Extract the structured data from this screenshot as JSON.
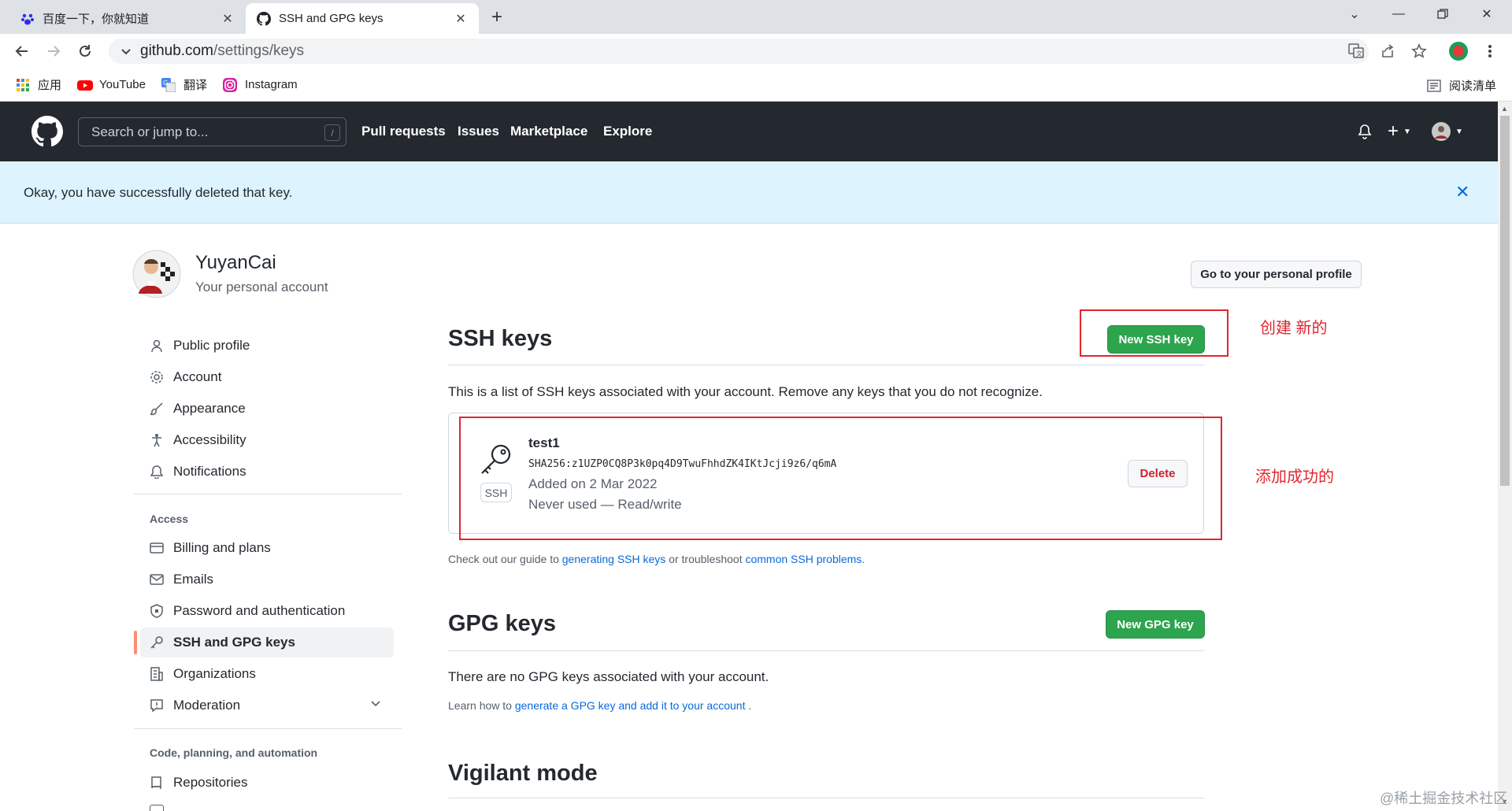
{
  "browser": {
    "tabs": [
      {
        "title": "百度一下，你就知道",
        "icon": "baidu-paw-icon",
        "active": false
      },
      {
        "title": "SSH and GPG keys",
        "icon": "github-icon",
        "active": true
      }
    ],
    "url_host": "github.com",
    "url_path": "/settings/keys",
    "bookmarks": [
      {
        "label": "应用",
        "icon": "apps-grid-icon"
      },
      {
        "label": "YouTube",
        "icon": "youtube-icon"
      },
      {
        "label": "翻译",
        "icon": "translate-icon"
      },
      {
        "label": "Instagram",
        "icon": "instagram-icon"
      }
    ],
    "reading_list": "阅读清单"
  },
  "github": {
    "search_placeholder": "Search or jump to...",
    "search_shortcut": "/",
    "nav": [
      "Pull requests",
      "Issues",
      "Marketplace",
      "Explore"
    ]
  },
  "flash": {
    "message": "Okay, you have successfully deleted that key.",
    "color": "#ddf4ff"
  },
  "account": {
    "name": "YuyanCai",
    "subtitle": "Your personal account",
    "profile_button": "Go to your personal profile"
  },
  "sidebar": {
    "items_top": [
      {
        "label": "Public profile",
        "icon": "person-icon"
      },
      {
        "label": "Account",
        "icon": "gear-icon"
      },
      {
        "label": "Appearance",
        "icon": "paintbrush-icon"
      },
      {
        "label": "Accessibility",
        "icon": "accessibility-icon"
      },
      {
        "label": "Notifications",
        "icon": "bell-icon"
      }
    ],
    "access_heading": "Access",
    "items_access": [
      {
        "label": "Billing and plans",
        "icon": "credit-card-icon"
      },
      {
        "label": "Emails",
        "icon": "mail-icon"
      },
      {
        "label": "Password and authentication",
        "icon": "shield-lock-icon"
      },
      {
        "label": "SSH and GPG keys",
        "icon": "key-icon",
        "selected": true
      },
      {
        "label": "Organizations",
        "icon": "organization-icon"
      },
      {
        "label": "Moderation",
        "icon": "report-icon"
      }
    ],
    "code_heading": "Code, planning, and automation",
    "items_code": [
      {
        "label": "Repositories",
        "icon": "repo-icon"
      }
    ]
  },
  "ssh": {
    "title": "SSH keys",
    "new_button": "New SSH key",
    "description": "This is a list of SSH keys associated with your account. Remove any keys that you do not recognize.",
    "key": {
      "name": "test1",
      "fingerprint": "SHA256:z1UZP0CQ8P3k0pq4D9TwuFhhdZK4IKtJcji9z6/q6mA",
      "added": "Added on 2 Mar 2022",
      "usage": "Never used — Read/write",
      "badge": "SSH",
      "delete_label": "Delete"
    },
    "guide_prefix": "Check out our guide to ",
    "guide_link1": "generating SSH keys",
    "guide_middle": " or troubleshoot ",
    "guide_link2": "common SSH problems",
    "guide_suffix": "."
  },
  "gpg": {
    "title": "GPG keys",
    "new_button": "New GPG key",
    "empty": "There are no GPG keys associated with your account.",
    "learn_prefix": "Learn how to ",
    "learn_link": "generate a GPG key and add it to your account",
    "learn_suffix": " ."
  },
  "vigilant": {
    "title": "Vigilant mode"
  },
  "annotations": {
    "new_label": "创建 新的",
    "added_label": "添加成功的",
    "color": "#e0262f"
  },
  "watermark": "@稀土掘金技术社区"
}
